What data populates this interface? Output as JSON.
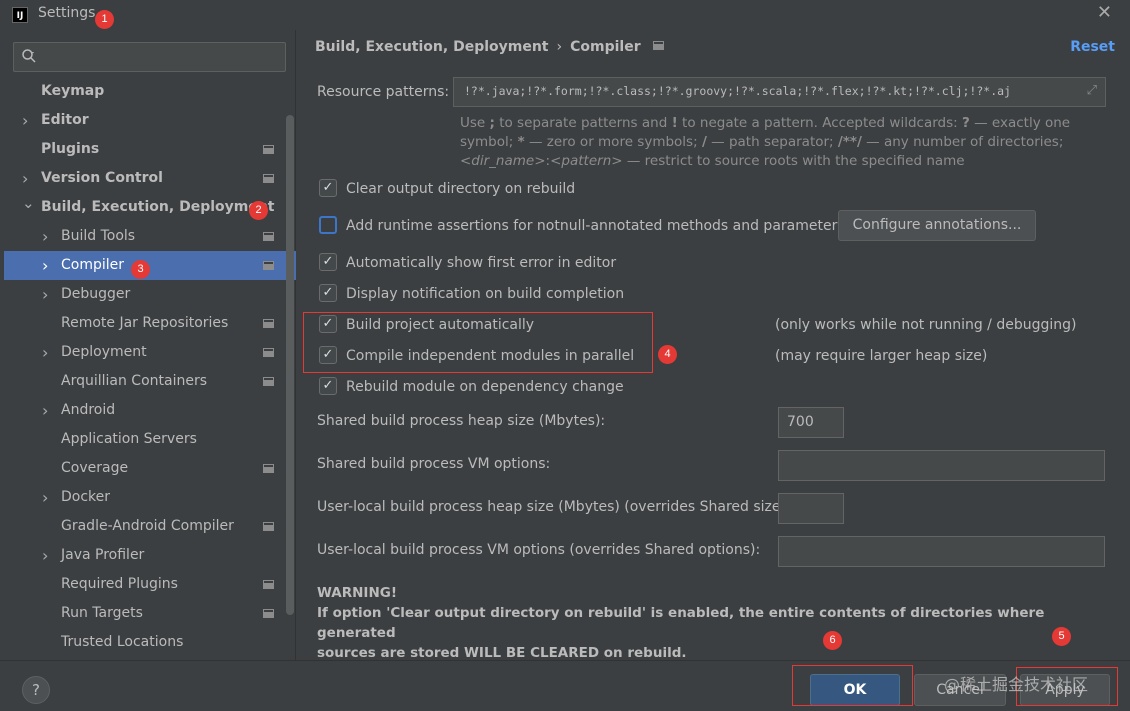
{
  "window": {
    "app_icon": "IJ",
    "title": "Settings",
    "close_icon": "✕"
  },
  "sidebar": {
    "search_placeholder": "",
    "items": [
      {
        "label": "Keymap",
        "bold": true
      },
      {
        "label": "Editor",
        "bold": true,
        "expandable": true
      },
      {
        "label": "Plugins",
        "bold": true,
        "page_icon": true
      },
      {
        "label": "Version Control",
        "bold": true,
        "expandable": true,
        "page_icon": true
      },
      {
        "label": "Build, Execution, Deployment",
        "bold": true,
        "expanded": true
      },
      {
        "label": "Build Tools",
        "expandable": true,
        "page_icon": true
      },
      {
        "label": "Compiler",
        "expandable": true,
        "page_icon": true,
        "selected": true
      },
      {
        "label": "Debugger",
        "expandable": true
      },
      {
        "label": "Remote Jar Repositories",
        "page_icon": true
      },
      {
        "label": "Deployment",
        "expandable": true,
        "page_icon": true
      },
      {
        "label": "Arquillian Containers",
        "page_icon": true
      },
      {
        "label": "Android",
        "expandable": true
      },
      {
        "label": "Application Servers"
      },
      {
        "label": "Coverage",
        "page_icon": true
      },
      {
        "label": "Docker",
        "expandable": true
      },
      {
        "label": "Gradle-Android Compiler",
        "page_icon": true
      },
      {
        "label": "Java Profiler",
        "expandable": true
      },
      {
        "label": "Required Plugins",
        "page_icon": true
      },
      {
        "label": "Run Targets",
        "page_icon": true
      },
      {
        "label": "Trusted Locations"
      }
    ]
  },
  "main": {
    "breadcrumb": {
      "part1": "Build, Execution, Deployment",
      "sep": "›",
      "part2": "Compiler"
    },
    "reset_label": "Reset",
    "resource_label": "Resource patterns:",
    "resource_value": "!?*.java;!?*.form;!?*.class;!?*.groovy;!?*.scala;!?*.flex;!?*.kt;!?*.clj;!?*.aj",
    "hint": {
      "l1a": "Use ",
      "l1b": ";",
      "l1c": " to separate patterns and ",
      "l1d": "!",
      "l1e": " to negate a pattern. Accepted wildcards: ",
      "l1f": "?",
      "l1g": " — exactly one",
      "l2a": "symbol; ",
      "l2b": "*",
      "l2c": " — zero or more symbols; ",
      "l2d": "/",
      "l2e": " — path separator; ",
      "l2f": "/**/",
      "l2g": " — any number of directories;",
      "l3a": "<dir_name>",
      "l3b": ":",
      "l3c": "<pattern>",
      "l3d": " — restrict to source roots with the specified name"
    },
    "checkboxes": {
      "clear_output": {
        "label": "Clear output directory on rebuild",
        "checked": true
      },
      "runtime_assertions": {
        "label": "Add runtime assertions for notnull-annotated methods and parameters",
        "checked": false
      },
      "show_first_error": {
        "label": "Automatically show first error in editor",
        "checked": true
      },
      "display_notification": {
        "label": "Display notification on build completion",
        "checked": true
      },
      "build_automatically": {
        "label": "Build project automatically",
        "checked": true
      },
      "compile_parallel": {
        "label": "Compile independent modules in parallel",
        "checked": true
      },
      "rebuild_on_dependency": {
        "label": "Rebuild module on dependency change",
        "checked": true
      }
    },
    "configure_annotations_label": "Configure annotations...",
    "notes": {
      "build_auto": "(only works while not running / debugging)",
      "parallel": "(may require larger heap size)"
    },
    "fields": {
      "shared_heap_label": "Shared build process heap size (Mbytes):",
      "shared_heap_value": "700",
      "shared_vm_label": "Shared build process VM options:",
      "shared_vm_value": "",
      "user_heap_label": "User-local build process heap size (Mbytes) (overrides Shared size):",
      "user_heap_value": "",
      "user_vm_label": "User-local build process VM options (overrides Shared options):",
      "user_vm_value": ""
    },
    "warning": {
      "title": "WARNING!",
      "l1": "If option 'Clear output directory on rebuild' is enabled, the entire contents of directories where generated",
      "l2": "sources are stored WILL BE CLEARED on rebuild."
    }
  },
  "footer": {
    "help_label": "?",
    "ok_label": "OK",
    "cancel_label": "Cancel",
    "apply_label": "Apply",
    "watermark": "@稀土掘金技术社区"
  },
  "annotations": {
    "b1": "1",
    "b2": "2",
    "b3": "3",
    "b4": "4",
    "b5": "5",
    "b6": "6"
  },
  "colors": {
    "background": "#3c3f41",
    "selection": "#4b6eaf",
    "link": "#589df6",
    "ok_button": "#365880",
    "annotation_red": "#e53935"
  }
}
